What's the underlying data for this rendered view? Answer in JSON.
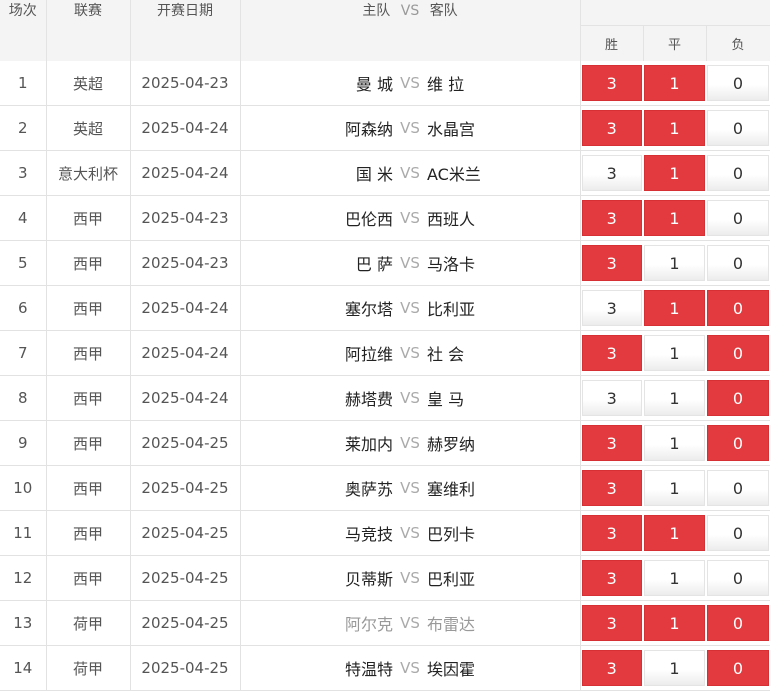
{
  "header": {
    "index": "场次",
    "league": "联赛",
    "date": "开赛日期",
    "home": "主队",
    "vs": "VS",
    "away": "客队",
    "win": "胜",
    "draw": "平",
    "lose": "负"
  },
  "colors": {
    "selected": "#e23a3e",
    "header_bg": "#f4f4f4"
  },
  "rows": [
    {
      "no": "1",
      "league": "英超",
      "date": "2025-04-23",
      "home": "曼 城",
      "away": "维 拉",
      "win": "3",
      "draw": "1",
      "lose": "0",
      "sel": [
        1,
        1,
        0
      ],
      "home_gray": false,
      "away_gray": false
    },
    {
      "no": "2",
      "league": "英超",
      "date": "2025-04-24",
      "home": "阿森纳",
      "away": "水晶宫",
      "win": "3",
      "draw": "1",
      "lose": "0",
      "sel": [
        1,
        1,
        0
      ],
      "home_gray": false,
      "away_gray": false
    },
    {
      "no": "3",
      "league": "意大利杯",
      "date": "2025-04-24",
      "home": "国 米",
      "away": "AC米兰",
      "win": "3",
      "draw": "1",
      "lose": "0",
      "sel": [
        0,
        1,
        0
      ],
      "home_gray": false,
      "away_gray": false
    },
    {
      "no": "4",
      "league": "西甲",
      "date": "2025-04-23",
      "home": "巴伦西",
      "away": "西班人",
      "win": "3",
      "draw": "1",
      "lose": "0",
      "sel": [
        1,
        1,
        0
      ],
      "home_gray": false,
      "away_gray": false
    },
    {
      "no": "5",
      "league": "西甲",
      "date": "2025-04-23",
      "home": "巴 萨",
      "away": "马洛卡",
      "win": "3",
      "draw": "1",
      "lose": "0",
      "sel": [
        1,
        0,
        0
      ],
      "home_gray": false,
      "away_gray": false
    },
    {
      "no": "6",
      "league": "西甲",
      "date": "2025-04-24",
      "home": "塞尔塔",
      "away": "比利亚",
      "win": "3",
      "draw": "1",
      "lose": "0",
      "sel": [
        0,
        1,
        1
      ],
      "home_gray": false,
      "away_gray": false
    },
    {
      "no": "7",
      "league": "西甲",
      "date": "2025-04-24",
      "home": "阿拉维",
      "away": "社 会",
      "win": "3",
      "draw": "1",
      "lose": "0",
      "sel": [
        1,
        0,
        1
      ],
      "home_gray": false,
      "away_gray": false
    },
    {
      "no": "8",
      "league": "西甲",
      "date": "2025-04-24",
      "home": "赫塔费",
      "away": "皇 马",
      "win": "3",
      "draw": "1",
      "lose": "0",
      "sel": [
        0,
        0,
        1
      ],
      "home_gray": false,
      "away_gray": false
    },
    {
      "no": "9",
      "league": "西甲",
      "date": "2025-04-25",
      "home": "莱加内",
      "away": "赫罗纳",
      "win": "3",
      "draw": "1",
      "lose": "0",
      "sel": [
        1,
        0,
        1
      ],
      "home_gray": false,
      "away_gray": false
    },
    {
      "no": "10",
      "league": "西甲",
      "date": "2025-04-25",
      "home": "奥萨苏",
      "away": "塞维利",
      "win": "3",
      "draw": "1",
      "lose": "0",
      "sel": [
        1,
        0,
        0
      ],
      "home_gray": false,
      "away_gray": false
    },
    {
      "no": "11",
      "league": "西甲",
      "date": "2025-04-25",
      "home": "马竞技",
      "away": "巴列卡",
      "win": "3",
      "draw": "1",
      "lose": "0",
      "sel": [
        1,
        1,
        0
      ],
      "home_gray": false,
      "away_gray": false
    },
    {
      "no": "12",
      "league": "西甲",
      "date": "2025-04-25",
      "home": "贝蒂斯",
      "away": "巴利亚",
      "win": "3",
      "draw": "1",
      "lose": "0",
      "sel": [
        1,
        0,
        0
      ],
      "home_gray": false,
      "away_gray": false
    },
    {
      "no": "13",
      "league": "荷甲",
      "date": "2025-04-25",
      "home": "阿尔克",
      "away": "布雷达",
      "win": "3",
      "draw": "1",
      "lose": "0",
      "sel": [
        1,
        1,
        1
      ],
      "home_gray": true,
      "away_gray": true
    },
    {
      "no": "14",
      "league": "荷甲",
      "date": "2025-04-25",
      "home": "特温特",
      "away": "埃因霍",
      "win": "3",
      "draw": "1",
      "lose": "0",
      "sel": [
        1,
        0,
        1
      ],
      "home_gray": false,
      "away_gray": false
    }
  ]
}
